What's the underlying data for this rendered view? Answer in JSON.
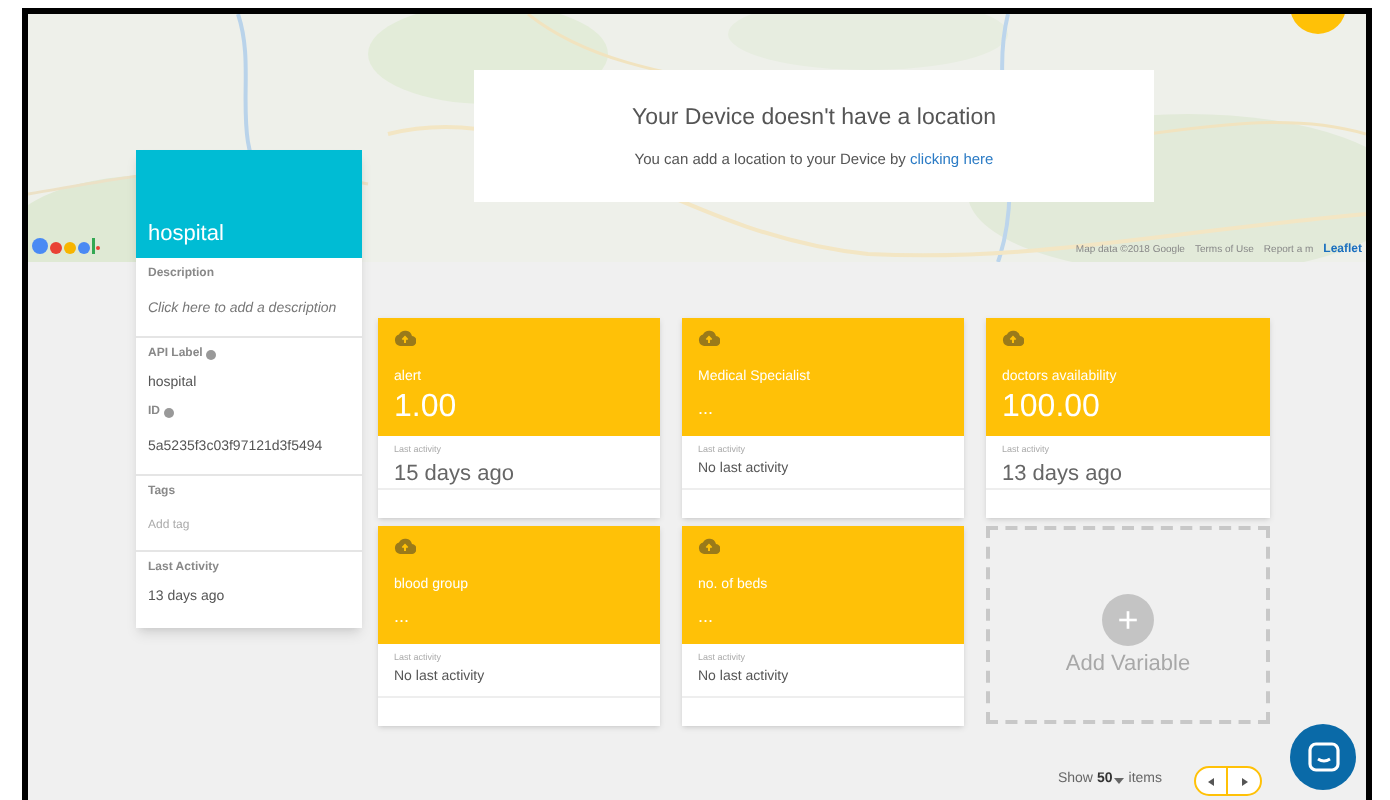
{
  "map": {
    "attribution": [
      "Map data ©2018 Google",
      "Terms of Use",
      "Report a m"
    ],
    "leaflet_link": "Leaflet"
  },
  "location_notice": {
    "title": "Your Device doesn't have a location",
    "text": "You can add a location to your Device by ",
    "link": "clicking here"
  },
  "device": {
    "name": "hospital",
    "description_label": "Description",
    "description_placeholder": "Click here to add a description",
    "api_label_label": "API Label",
    "api_label": "hospital",
    "id_label": "ID",
    "id": "5a5235f3c03f97121d3f5494",
    "tags_label": "Tags",
    "tags_placeholder": "Add tag",
    "last_activity_label": "Last Activity",
    "last_activity": "13 days ago"
  },
  "variables": [
    {
      "name": "alert",
      "value": "1.00",
      "activity_label": "Last activity",
      "activity": "15 days ago",
      "kind": "reading"
    },
    {
      "name": "Medical Specialist",
      "value": "...",
      "activity_label": "Last activity",
      "activity": "No last activity",
      "kind": "empty"
    },
    {
      "name": "doctors availability",
      "value": "100.00",
      "activity_label": "Last activity",
      "activity": "13 days ago",
      "kind": "reading"
    },
    {
      "name": "blood group",
      "value": "...",
      "activity_label": "Last activity",
      "activity": "No last activity",
      "kind": "empty"
    },
    {
      "name": "no. of beds",
      "value": "...",
      "activity_label": "Last activity",
      "activity": "No last activity",
      "kind": "empty"
    }
  ],
  "add_variable": {
    "label": "Add Variable",
    "icon": "+"
  },
  "pagination": {
    "show": "Show",
    "count": "50",
    "items": "items"
  }
}
